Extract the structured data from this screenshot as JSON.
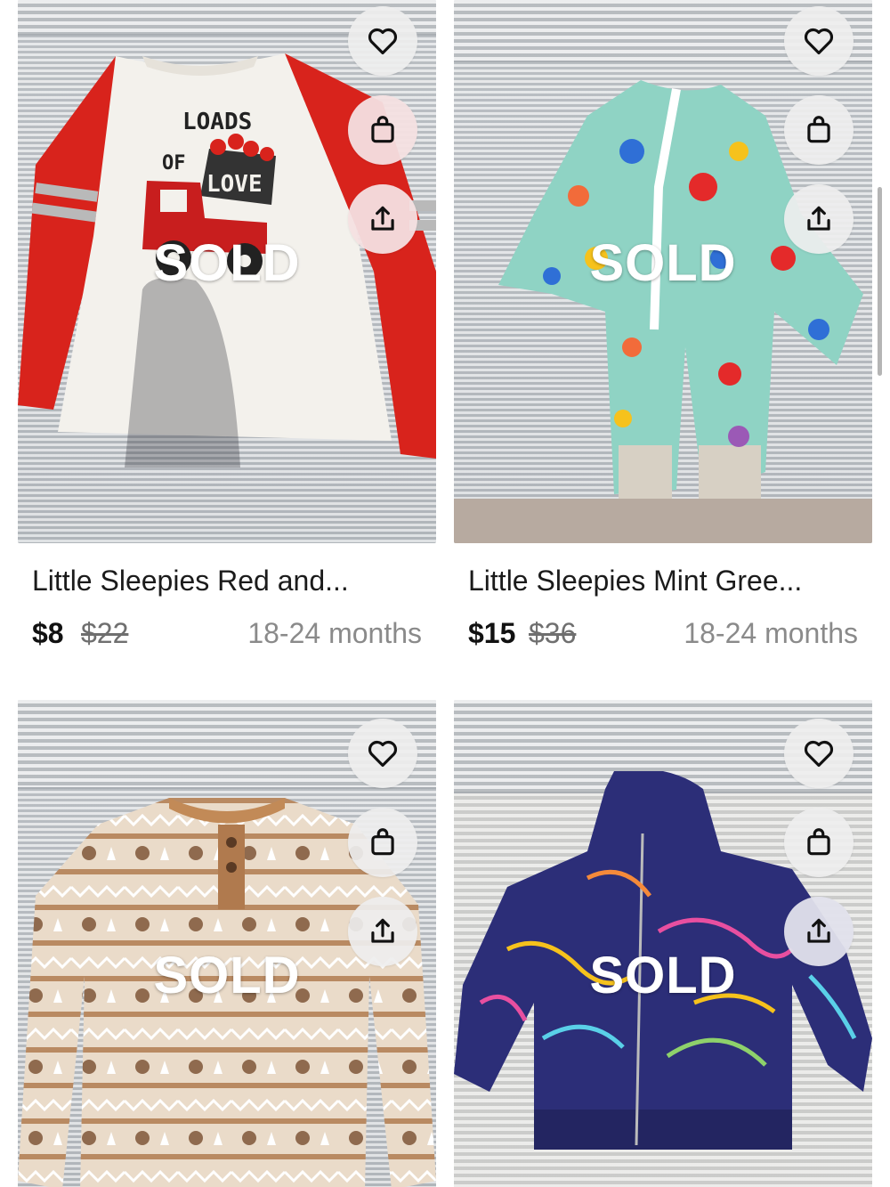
{
  "listings": [
    {
      "title": "Little Sleepies Red and...",
      "price": "$8",
      "original_price": "$22",
      "size": "18-24 months",
      "status": "SOLD",
      "graphic_text_1": "LOADS",
      "graphic_text_2": "OF",
      "graphic_text_3": "LOVE"
    },
    {
      "title": "Little Sleepies Mint Gree...",
      "price": "$15",
      "original_price": "$36",
      "size": "18-24 months",
      "status": "SOLD"
    },
    {
      "title": "",
      "price": "",
      "original_price": "",
      "size": "",
      "status": "SOLD"
    },
    {
      "title": "",
      "price": "",
      "original_price": "",
      "size": "",
      "status": "SOLD"
    }
  ],
  "icons": {
    "like": "heart-icon",
    "bag": "shopping-bag-icon",
    "share": "share-icon"
  },
  "colors": {
    "sold_text": "#ffffff",
    "price_text": "#111111",
    "strike_price": "#6f6f6f",
    "size_text": "#8a8a8a"
  }
}
